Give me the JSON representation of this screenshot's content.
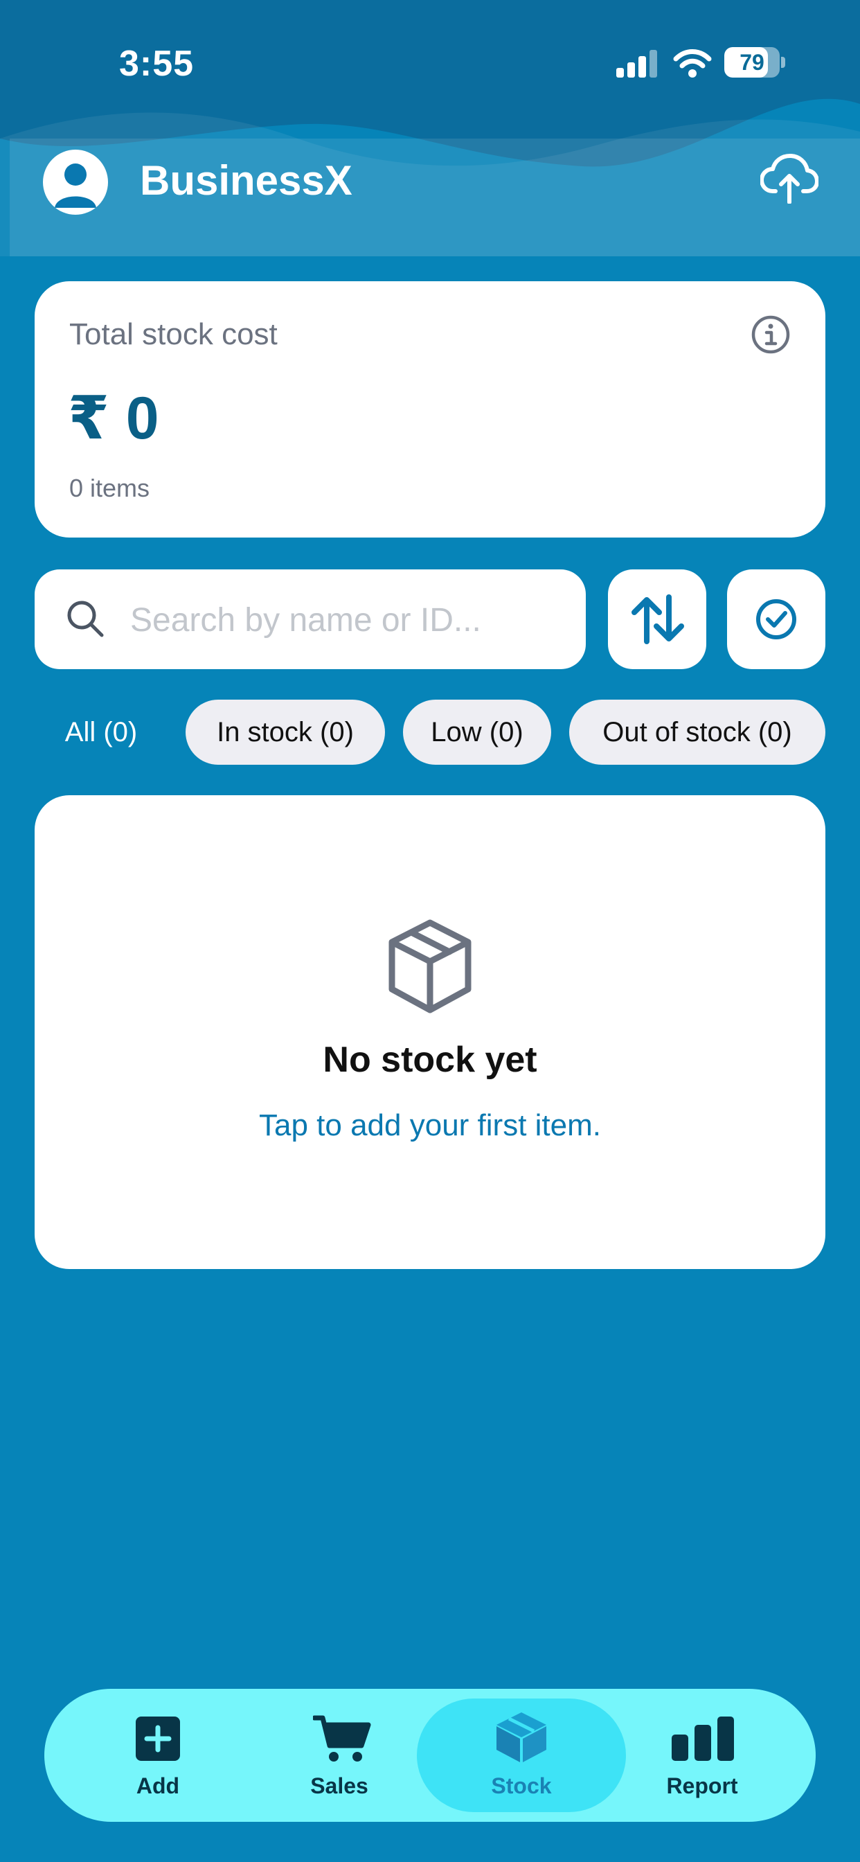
{
  "status_bar": {
    "time": "3:55",
    "battery": "79"
  },
  "header": {
    "title": "BusinessX",
    "avatar_icon": "user-avatar-icon",
    "action_icon": "cloud-upload-icon"
  },
  "summary": {
    "label": "Total stock cost",
    "amount": "₹ 0",
    "count": "0 items",
    "info_icon": "info-icon"
  },
  "search": {
    "placeholder": "Search by name or ID...",
    "value": "",
    "sort_icon": "sort-arrows-icon",
    "select_icon": "check-circle-icon"
  },
  "filters": [
    {
      "label": "All (0)",
      "selected": true
    },
    {
      "label": "In stock (0)",
      "selected": false
    },
    {
      "label": "Low (0)",
      "selected": false
    },
    {
      "label": "Out of stock (0)",
      "selected": false
    }
  ],
  "empty_state": {
    "icon": "box-icon",
    "title": "No stock yet",
    "subtitle": "Tap to add your first item."
  },
  "nav": [
    {
      "label": "Add",
      "icon": "add-icon",
      "active": false
    },
    {
      "label": "Sales",
      "icon": "cart-icon",
      "active": false
    },
    {
      "label": "Stock",
      "icon": "box-icon",
      "active": true
    },
    {
      "label": "Report",
      "icon": "bar-chart-icon",
      "active": false
    }
  ],
  "colors": {
    "background": "#0684b8",
    "accent": "#0a78b0",
    "nav_bg": "#76f6fb",
    "nav_active": "#3ee3f6"
  }
}
